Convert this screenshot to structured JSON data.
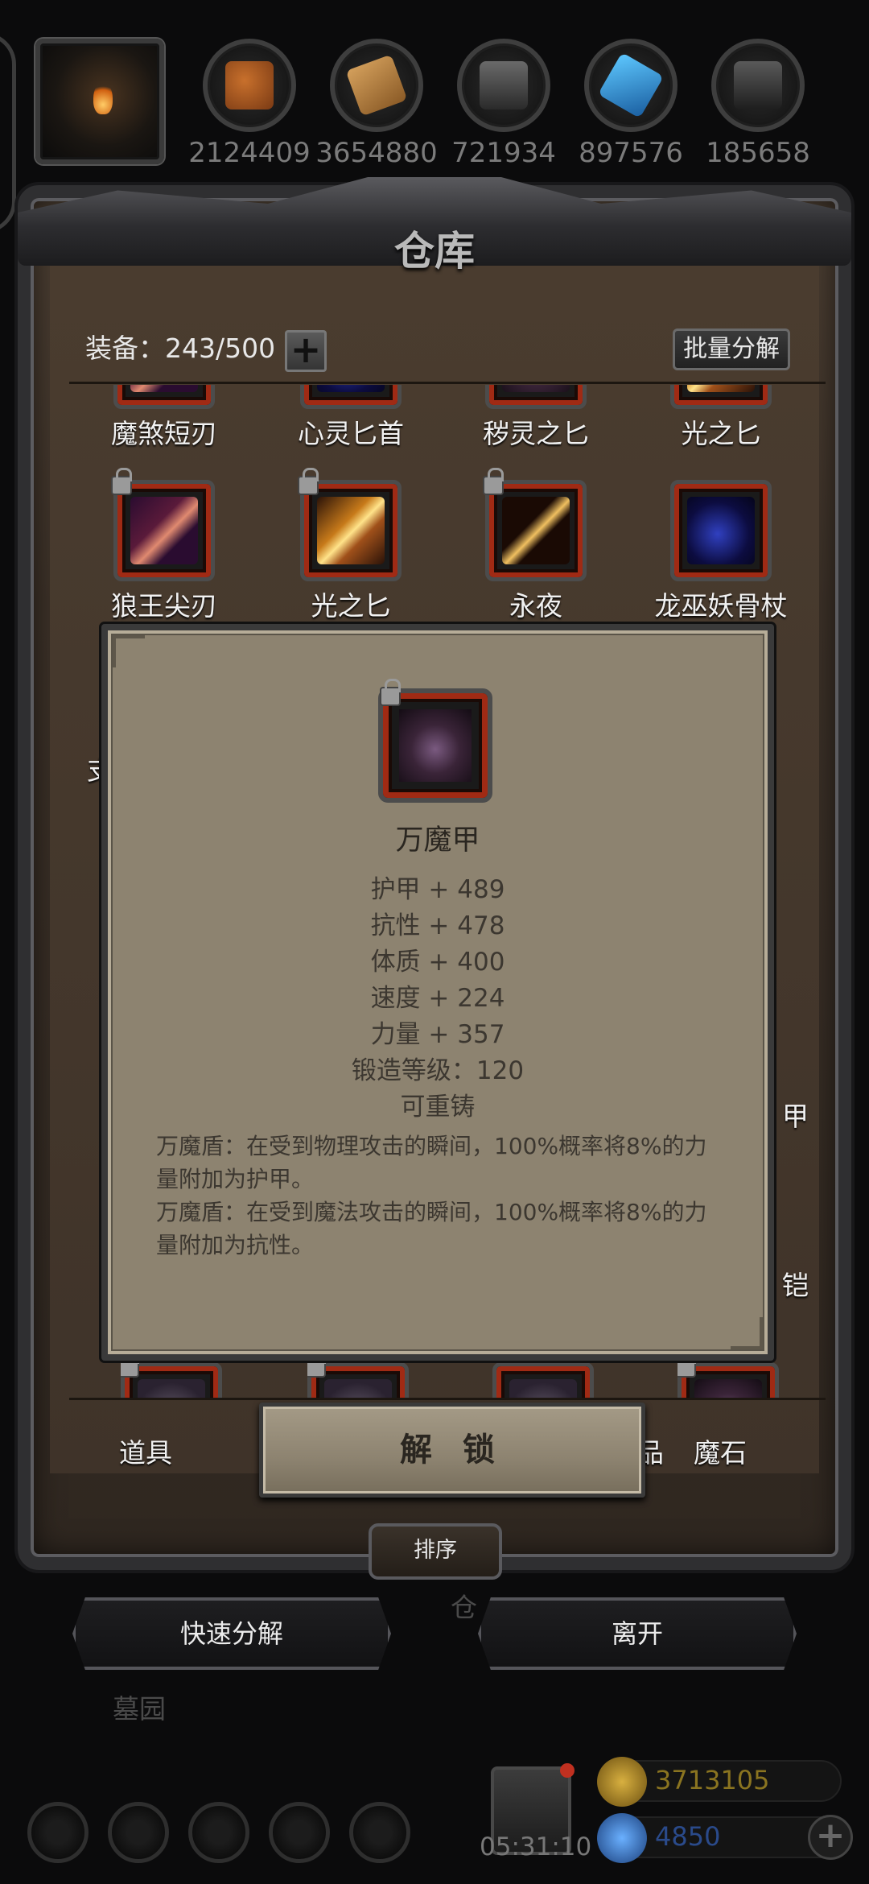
{
  "resources": [
    {
      "icon": "meat-icon",
      "value": "2124409"
    },
    {
      "icon": "wood-icon",
      "value": "3654880"
    },
    {
      "icon": "iron-icon",
      "value": "721934"
    },
    {
      "icon": "crystal-icon",
      "value": "897576"
    },
    {
      "icon": "stone-icon",
      "value": "185658"
    }
  ],
  "warehouse": {
    "title": "仓库",
    "equip_count": "装备：243/500",
    "plus_label": "+",
    "batch_label": "批量分解",
    "items_row0": [
      "魔煞短刃",
      "心灵匕首",
      "秽灵之匕",
      "光之匕"
    ],
    "items_row1": [
      "狼王尖刃",
      "光之匕",
      "永夜",
      "龙巫妖骨杖"
    ],
    "partial_left": "支",
    "partial_right_1": "甲",
    "partial_right_2": "铠"
  },
  "tooltip": {
    "name": "万魔甲",
    "stats": [
      "护甲 + 489",
      "抗性 + 478",
      "体质 + 400",
      "速度 + 224",
      "力量 + 357",
      "锻造等级：120",
      "可重铸"
    ],
    "desc1": "万魔盾：在受到物理攻击的瞬间，100%概率将8%的力量附加为护甲。",
    "desc2": "万魔盾：在受到魔法攻击的瞬间，100%概率将8%的力量附加为抗性。"
  },
  "tabs": {
    "items": "道具",
    "unlock": "解 锁",
    "hidden_tab_tail": "品",
    "magic_stone": "魔石"
  },
  "sort_label": "排序",
  "actions": {
    "quick_decompose": "快速分解",
    "leave": "离开"
  },
  "background": {
    "ghost_top": "仓",
    "ghost_bottom": "墓园"
  },
  "bottom": {
    "timer": "05:31:10",
    "gold": "3713105",
    "gems": "4850",
    "gold_color": "#8a7420",
    "gem_color": "#2a4a8a"
  }
}
